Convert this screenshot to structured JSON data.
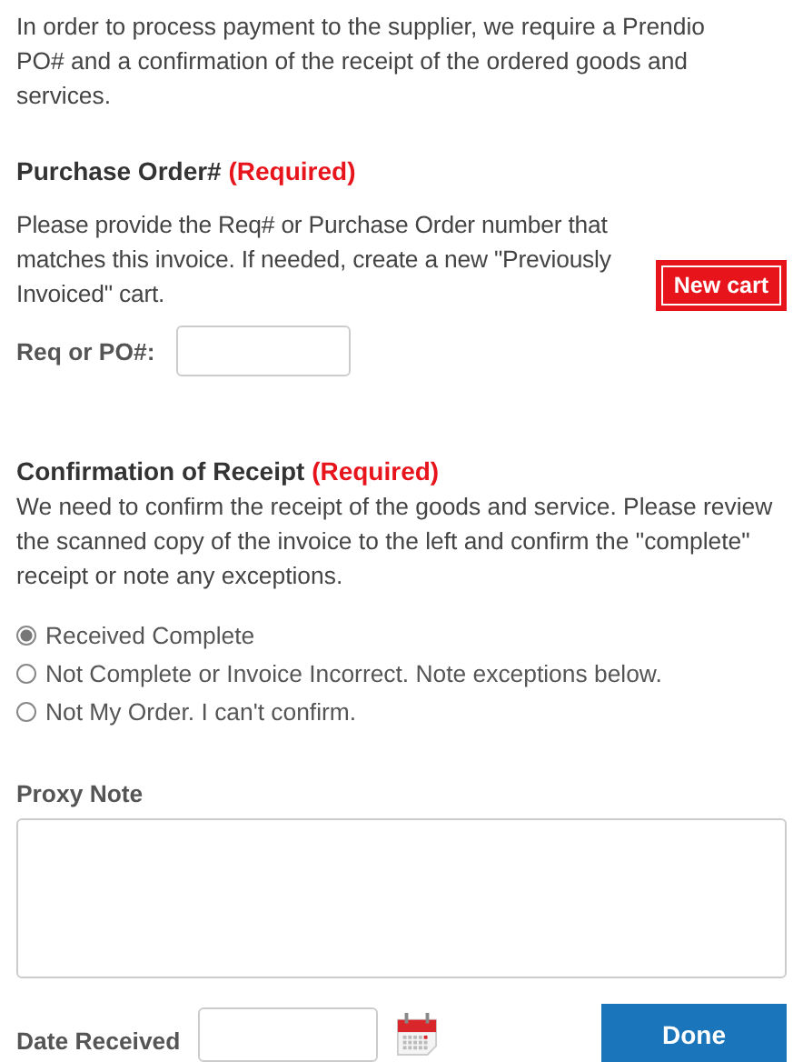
{
  "intro": "In order to process payment to the supplier, we require a Prendio PO# and a confirmation of the receipt of the ordered goods and services.",
  "purchase_order": {
    "heading": "Purchase Order#",
    "required": "(Required)",
    "description": "Please provide the Req# or Purchase Order number that matches this invoice. If needed, create a new \"Previously Invoiced\" cart.",
    "new_cart_button": "New cart",
    "field_label": "Req or PO#:"
  },
  "receipt": {
    "heading": "Confirmation of Receipt",
    "required": "(Required)",
    "description": "We need to confirm the receipt of the goods and service. Please review the scanned copy of the invoice to the left and confirm the \"complete\" receipt or note any exceptions.",
    "options": [
      {
        "label": "Received Complete",
        "selected": true
      },
      {
        "label": "Not Complete or Invoice Incorrect. Note exceptions below.",
        "selected": false
      },
      {
        "label": "Not My Order. I can't confirm.",
        "selected": false
      }
    ]
  },
  "proxy_note": {
    "label": "Proxy Note"
  },
  "date_received": {
    "label": "Date Received"
  },
  "done_button": "Done"
}
